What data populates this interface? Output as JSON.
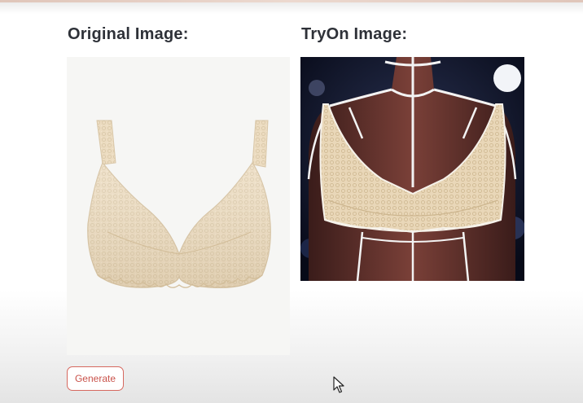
{
  "main": {
    "original": {
      "heading": "Original Image:",
      "image_icon": "bra-product-photo"
    },
    "tryon": {
      "heading": "TryOn Image:",
      "image_icon": "mannequin-tryon-photo"
    },
    "generate_label": "Generate"
  },
  "colors": {
    "heading_text": "#2e3138",
    "button_border": "#d6685f",
    "button_text": "#c9524a",
    "lace": "#ecdcc1",
    "original_background": "#f6f6f4",
    "tryon_background": "#0b1022",
    "mannequin": "#5a2f2a"
  }
}
